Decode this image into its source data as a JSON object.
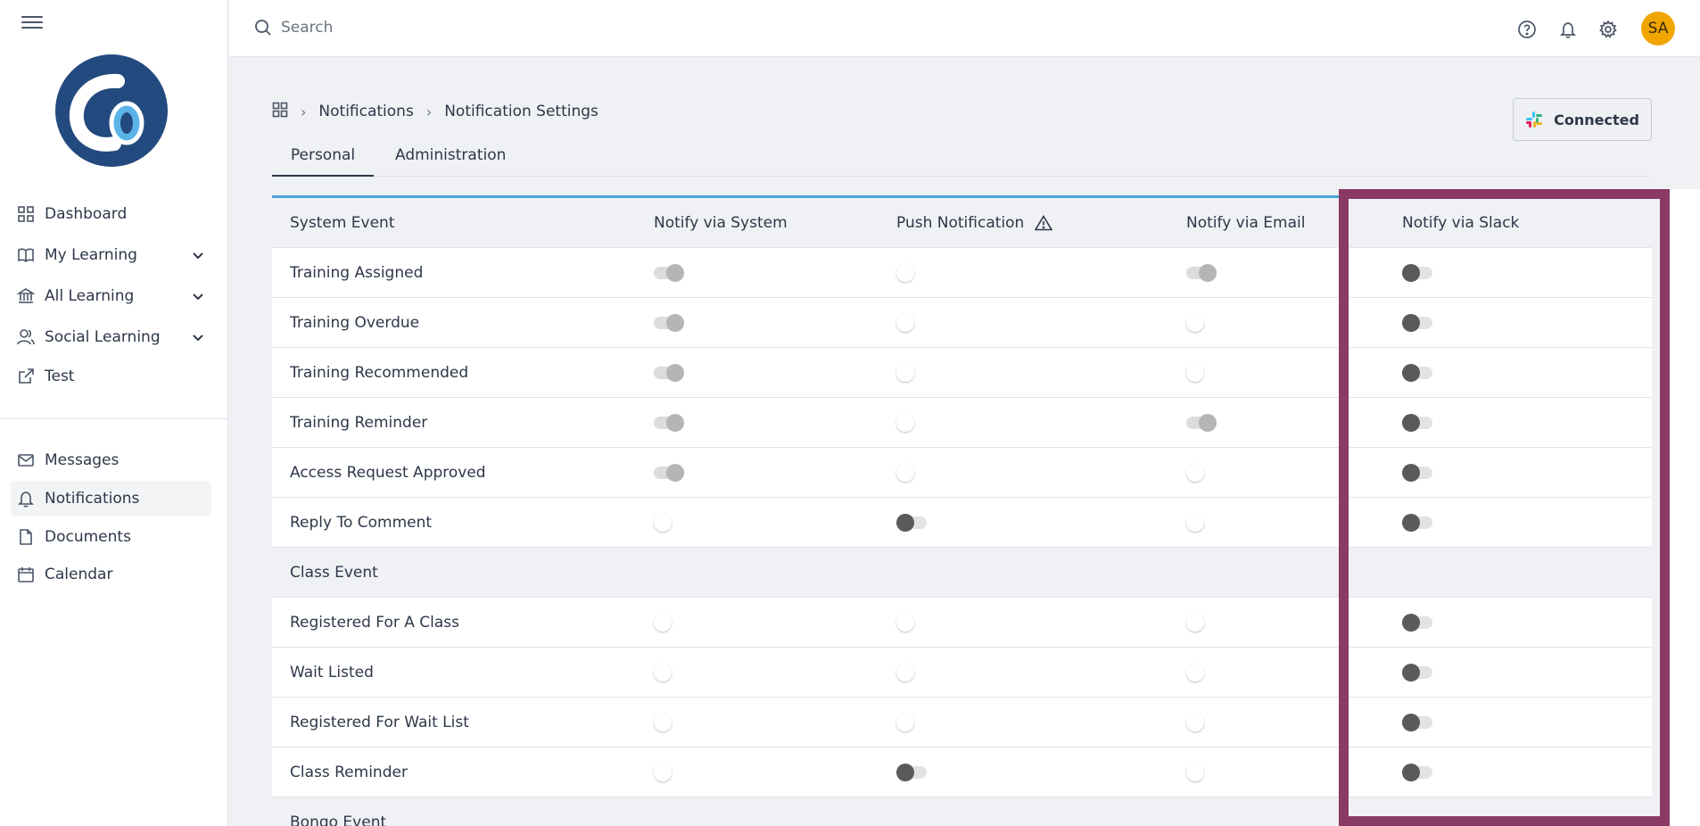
{
  "sidebar": {
    "nav_top": [
      {
        "label": "Dashboard",
        "icon": "grid-icon",
        "expandable": false
      },
      {
        "label": "My Learning",
        "icon": "book-icon",
        "expandable": true
      },
      {
        "label": "All Learning",
        "icon": "bank-icon",
        "expandable": true
      },
      {
        "label": "Social Learning",
        "icon": "users-icon",
        "expandable": true
      },
      {
        "label": "Test",
        "icon": "external-link-icon",
        "expandable": false
      }
    ],
    "nav_bottom": [
      {
        "label": "Messages",
        "icon": "mail-icon"
      },
      {
        "label": "Notifications",
        "icon": "bell-icon",
        "active": true
      },
      {
        "label": "Documents",
        "icon": "file-icon"
      },
      {
        "label": "Calendar",
        "icon": "calendar-icon"
      }
    ]
  },
  "topbar": {
    "search_placeholder": "Search",
    "avatar_initials": "SA",
    "avatar_color": "#f0a500"
  },
  "breadcrumb": [
    "Notifications",
    "Notification Settings"
  ],
  "slack_button": {
    "label": "Connected"
  },
  "tabs": [
    {
      "label": "Personal",
      "active": true
    },
    {
      "label": "Administration",
      "active": false
    }
  ],
  "table": {
    "columns": [
      "System Event",
      "Notify via System",
      "Push Notification",
      "Notify via Email",
      "Notify via Slack"
    ],
    "rows": [
      {
        "type": "item",
        "label": "Training Assigned",
        "states": [
          "on-disabled",
          "off-light",
          "on-disabled",
          "off-dark"
        ]
      },
      {
        "type": "item",
        "label": "Training Overdue",
        "states": [
          "on-disabled",
          "off-light",
          "off-light",
          "off-dark"
        ]
      },
      {
        "type": "item",
        "label": "Training Recommended",
        "states": [
          "on-disabled",
          "off-light",
          "off-light",
          "off-dark"
        ]
      },
      {
        "type": "item",
        "label": "Training Reminder",
        "states": [
          "on-disabled",
          "off-light",
          "on-disabled",
          "off-dark"
        ]
      },
      {
        "type": "item",
        "label": "Access Request Approved",
        "states": [
          "on-disabled",
          "off-light",
          "off-light",
          "off-dark"
        ]
      },
      {
        "type": "item",
        "label": "Reply To Comment",
        "states": [
          "off-light",
          "off-dark",
          "off-light",
          "off-dark"
        ]
      },
      {
        "type": "section",
        "label": "Class Event"
      },
      {
        "type": "item",
        "label": "Registered For A Class",
        "states": [
          "off-light",
          "off-light",
          "off-light",
          "off-dark"
        ]
      },
      {
        "type": "item",
        "label": "Wait Listed",
        "states": [
          "off-light",
          "off-light",
          "off-light",
          "off-dark"
        ]
      },
      {
        "type": "item",
        "label": "Registered For Wait List",
        "states": [
          "off-light",
          "off-light",
          "off-light",
          "off-dark"
        ]
      },
      {
        "type": "item",
        "label": "Class Reminder",
        "states": [
          "off-light",
          "off-dark",
          "off-light",
          "off-dark"
        ]
      },
      {
        "type": "section",
        "label": "Bongo Event"
      }
    ]
  },
  "colors": {
    "accent_border": "#4aa3d8",
    "highlight_box": "#8a3a66",
    "logo_bg": "#234a7e"
  }
}
